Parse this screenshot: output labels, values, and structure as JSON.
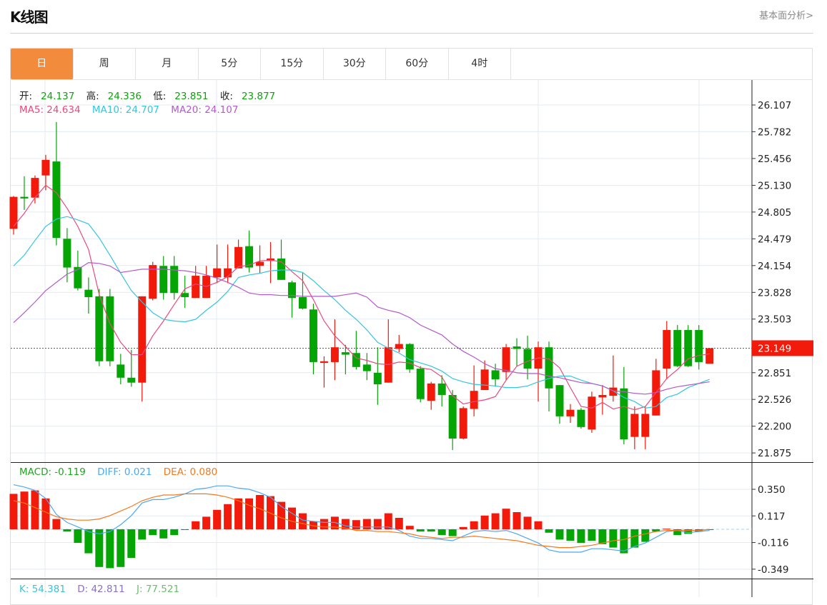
{
  "header": {
    "title": "K线图",
    "link": "基本面分析>"
  },
  "tabs": [
    {
      "label": "日",
      "active": true
    },
    {
      "label": "周"
    },
    {
      "label": "月"
    },
    {
      "label": "5分"
    },
    {
      "label": "15分"
    },
    {
      "label": "30分"
    },
    {
      "label": "60分"
    },
    {
      "label": "4时"
    }
  ],
  "ohlc_legend": {
    "open_label": "开:",
    "open": "24.137",
    "high_label": "高:",
    "high": "24.336",
    "low_label": "低:",
    "low": "23.851",
    "close_label": "收:",
    "close": "23.877"
  },
  "ma_legend": {
    "ma5": "MA5: 24.634",
    "ma10": "MA10: 24.707",
    "ma20": "MA20: 24.107"
  },
  "macd_legend": {
    "macd": "MACD: -0.119",
    "diff": "DIFF: 0.021",
    "dea": "DEA: 0.080"
  },
  "kdj_legend": {
    "k": "K: 54.381",
    "d": "D: 42.811",
    "j": "J: 77.521"
  },
  "colors": {
    "up": "#f21a0a",
    "down": "#06a506",
    "ma5": "#e94a7d",
    "ma10": "#34c6dc",
    "ma20": "#b35ac9",
    "diff": "#4fa8f2",
    "dea": "#f5791b",
    "accent": "#f28c3c"
  },
  "chart_data": [
    {
      "type": "candlestick",
      "title": "K线图",
      "y_ticks": [
        "26.107",
        "25.782",
        "25.456",
        "25.130",
        "24.805",
        "24.479",
        "24.154",
        "23.828",
        "23.503",
        "23.149",
        "22.851",
        "22.526",
        "22.200",
        "21.875"
      ],
      "ylim": [
        21.875,
        26.107
      ],
      "last_price": "23.149",
      "ohlc": [
        [
          24.6,
          25.0,
          24.53,
          24.99
        ],
        [
          24.99,
          25.24,
          24.83,
          24.97
        ],
        [
          24.98,
          25.25,
          24.91,
          25.22
        ],
        [
          25.25,
          25.5,
          25.07,
          25.44
        ],
        [
          25.42,
          25.9,
          24.4,
          24.49
        ],
        [
          24.48,
          24.61,
          23.95,
          24.13
        ],
        [
          24.137,
          24.336,
          23.851,
          23.877
        ],
        [
          23.86,
          24.01,
          23.57,
          23.77
        ],
        [
          23.78,
          23.87,
          22.93,
          22.99
        ],
        [
          23.78,
          23.87,
          22.93,
          22.99
        ],
        [
          22.95,
          23.08,
          22.71,
          22.79
        ],
        [
          22.79,
          23.13,
          22.68,
          22.73
        ],
        [
          22.73,
          23.78,
          22.5,
          23.78
        ],
        [
          23.75,
          24.2,
          23.73,
          24.16
        ],
        [
          24.15,
          24.27,
          23.74,
          23.82
        ],
        [
          24.15,
          24.27,
          23.74,
          23.82
        ],
        [
          23.82,
          24.03,
          23.64,
          23.77
        ],
        [
          23.76,
          24.15,
          23.76,
          24.03
        ],
        [
          23.76,
          24.15,
          23.76,
          24.03
        ],
        [
          24.01,
          24.41,
          23.94,
          24.12
        ],
        [
          24.01,
          24.41,
          23.94,
          24.12
        ],
        [
          24.12,
          24.47,
          24.12,
          24.38
        ],
        [
          24.39,
          24.58,
          24.07,
          24.13
        ],
        [
          24.15,
          24.4,
          24.06,
          24.2
        ],
        [
          24.21,
          24.44,
          23.94,
          24.24
        ],
        [
          24.24,
          24.47,
          23.98,
          23.98
        ],
        [
          23.95,
          23.97,
          23.52,
          23.76
        ],
        [
          23.77,
          24.07,
          23.62,
          23.63
        ],
        [
          23.62,
          23.69,
          22.83,
          22.98
        ],
        [
          22.97,
          23.05,
          22.67,
          22.99
        ],
        [
          22.98,
          23.5,
          22.76,
          23.16
        ],
        [
          23.1,
          23.19,
          22.83,
          23.07
        ],
        [
          23.09,
          23.36,
          22.89,
          22.92
        ],
        [
          22.95,
          23.09,
          22.76,
          22.87
        ],
        [
          22.85,
          23.16,
          22.46,
          22.71
        ],
        [
          22.73,
          23.5,
          22.73,
          23.16
        ],
        [
          23.14,
          23.31,
          23.1,
          23.2
        ],
        [
          23.2,
          23.21,
          22.85,
          22.89
        ],
        [
          22.9,
          22.93,
          22.49,
          22.53
        ],
        [
          22.51,
          22.74,
          22.4,
          22.72
        ],
        [
          22.72,
          22.82,
          22.44,
          22.58
        ],
        [
          22.58,
          22.64,
          21.91,
          22.05
        ],
        [
          22.05,
          22.44,
          22.04,
          22.42
        ],
        [
          22.41,
          22.94,
          22.32,
          22.63
        ],
        [
          22.64,
          23.0,
          22.64,
          22.89
        ],
        [
          22.88,
          22.96,
          22.68,
          22.77
        ],
        [
          22.86,
          23.2,
          22.76,
          23.16
        ],
        [
          23.17,
          23.27,
          22.93,
          23.14
        ],
        [
          23.14,
          23.3,
          22.77,
          22.9
        ],
        [
          22.9,
          23.23,
          22.5,
          23.16
        ],
        [
          23.16,
          23.23,
          22.38,
          22.66
        ],
        [
          22.7,
          22.7,
          22.23,
          22.32
        ],
        [
          22.32,
          22.47,
          22.24,
          22.4
        ],
        [
          22.4,
          22.42,
          22.17,
          22.19
        ],
        [
          22.16,
          22.62,
          22.12,
          22.56
        ],
        [
          22.55,
          22.7,
          22.34,
          22.58
        ],
        [
          22.57,
          23.06,
          22.5,
          22.67
        ],
        [
          22.66,
          22.92,
          21.98,
          22.04
        ],
        [
          22.07,
          22.44,
          21.92,
          22.35
        ],
        [
          22.07,
          22.44,
          21.92,
          22.35
        ],
        [
          22.33,
          23.02,
          22.33,
          22.88
        ],
        [
          22.9,
          23.48,
          22.77,
          23.37
        ],
        [
          23.37,
          23.43,
          22.92,
          22.93
        ],
        [
          23.37,
          23.43,
          22.92,
          22.93
        ],
        [
          23.37,
          23.43,
          22.89,
          22.98
        ],
        [
          22.96,
          23.149,
          22.96,
          23.149
        ]
      ],
      "series": [
        {
          "name": "MA5",
          "values": [
            24.63,
            24.79,
            24.98,
            25.13,
            25.04,
            24.85,
            24.63,
            24.35,
            23.8,
            23.45,
            23.22,
            23.07,
            23.07,
            23.3,
            23.48,
            23.68,
            23.87,
            23.93,
            23.9,
            23.95,
            24.02,
            24.14,
            24.16,
            24.21,
            24.22,
            24.2,
            24.08,
            23.97,
            23.74,
            23.48,
            23.3,
            23.17,
            23.03,
            23.0,
            22.96,
            22.95,
            22.98,
            22.97,
            22.91,
            22.89,
            22.8,
            22.57,
            22.47,
            22.5,
            22.52,
            22.56,
            22.76,
            22.93,
            22.99,
            23.03,
            23.02,
            22.91,
            22.67,
            22.44,
            22.42,
            22.49,
            22.41,
            22.44,
            22.4,
            22.44,
            22.61,
            22.78,
            22.89,
            23.02,
            23.06,
            23.08
          ]
        },
        {
          "name": "MA10",
          "values": [
            24.15,
            24.28,
            24.46,
            24.63,
            24.72,
            24.75,
            24.71,
            24.66,
            24.49,
            24.28,
            24.06,
            23.85,
            23.71,
            23.58,
            23.5,
            23.48,
            23.47,
            23.5,
            23.61,
            23.71,
            23.84,
            24.01,
            24.04,
            24.06,
            24.09,
            24.1,
            24.1,
            24.07,
            23.97,
            23.85,
            23.74,
            23.61,
            23.5,
            23.37,
            23.22,
            23.15,
            23.09,
            23.01,
            22.97,
            22.93,
            22.87,
            22.78,
            22.74,
            22.71,
            22.7,
            22.69,
            22.67,
            22.67,
            22.69,
            22.74,
            22.78,
            22.81,
            22.81,
            22.76,
            22.72,
            22.69,
            22.63,
            22.55,
            22.5,
            22.42,
            22.44,
            22.55,
            22.59,
            22.67,
            22.72,
            22.77
          ]
        },
        {
          "name": "MA20",
          "values": [
            23.46,
            23.58,
            23.71,
            23.85,
            23.95,
            24.05,
            24.107,
            24.19,
            24.18,
            24.15,
            24.07,
            24.09,
            24.11,
            24.11,
            24.11,
            24.1,
            24.09,
            24.07,
            24.04,
            24.0,
            23.95,
            23.89,
            23.82,
            23.8,
            23.8,
            23.79,
            23.79,
            23.78,
            23.78,
            23.78,
            23.78,
            23.8,
            23.82,
            23.77,
            23.65,
            23.61,
            23.58,
            23.52,
            23.43,
            23.37,
            23.31,
            23.2,
            23.11,
            23.04,
            22.96,
            22.9,
            22.88,
            22.85,
            22.84,
            22.84,
            22.81,
            22.79,
            22.76,
            22.73,
            22.72,
            22.69,
            22.63,
            22.62,
            22.6,
            22.59,
            22.61,
            22.65,
            22.68,
            22.7,
            22.72,
            22.74
          ]
        }
      ]
    },
    {
      "type": "bar+line",
      "title": "MACD",
      "y_ticks": [
        "0.350",
        "0.117",
        "-0.116",
        "-0.349"
      ],
      "ylim": [
        -0.349,
        0.35
      ],
      "series": [
        {
          "name": "MACD",
          "values": [
            0.31,
            0.33,
            0.34,
            0.27,
            0.09,
            -0.02,
            -0.119,
            -0.21,
            -0.33,
            -0.34,
            -0.33,
            -0.25,
            -0.09,
            -0.05,
            -0.08,
            -0.05,
            -0.005,
            0.07,
            0.11,
            0.17,
            0.22,
            0.27,
            0.27,
            0.3,
            0.29,
            0.24,
            0.19,
            0.14,
            0.07,
            0.09,
            0.11,
            0.09,
            0.08,
            0.09,
            0.09,
            0.14,
            0.1,
            0.03,
            -0.02,
            -0.02,
            -0.05,
            -0.06,
            0.02,
            0.07,
            0.12,
            0.14,
            0.18,
            0.15,
            0.11,
            0.07,
            -0.03,
            -0.09,
            -0.1,
            -0.12,
            -0.1,
            -0.13,
            -0.16,
            -0.21,
            -0.16,
            -0.11,
            -0.02,
            0.005,
            -0.05,
            -0.04,
            -0.02,
            -0.005
          ]
        },
        {
          "name": "DIFF",
          "values": [
            0.39,
            0.37,
            0.34,
            0.27,
            0.13,
            0.06,
            0.021,
            -0.02,
            -0.04,
            -0.02,
            0.04,
            0.12,
            0.23,
            0.26,
            0.26,
            0.28,
            0.31,
            0.35,
            0.36,
            0.38,
            0.38,
            0.36,
            0.35,
            0.32,
            0.28,
            0.2,
            0.14,
            0.08,
            0.07,
            0.06,
            0.06,
            0.03,
            0.02,
            0.02,
            0.02,
            0.02,
            -0.01,
            -0.06,
            -0.08,
            -0.08,
            -0.09,
            -0.1,
            -0.06,
            -0.02,
            -0.01,
            -0.02,
            -0.01,
            -0.04,
            -0.08,
            -0.12,
            -0.18,
            -0.2,
            -0.2,
            -0.2,
            -0.17,
            -0.17,
            -0.18,
            -0.19,
            -0.15,
            -0.12,
            -0.07,
            -0.02,
            -0.01,
            -0.03,
            -0.02,
            -0.01
          ]
        },
        {
          "name": "DEA",
          "values": [
            0.25,
            0.23,
            0.19,
            0.15,
            0.11,
            0.09,
            0.08,
            0.08,
            0.09,
            0.12,
            0.16,
            0.2,
            0.25,
            0.28,
            0.3,
            0.3,
            0.31,
            0.31,
            0.31,
            0.3,
            0.28,
            0.25,
            0.21,
            0.18,
            0.14,
            0.1,
            0.07,
            0.05,
            0.03,
            0.02,
            0.02,
            0.01,
            -0.01,
            -0.01,
            -0.02,
            -0.02,
            -0.03,
            -0.04,
            -0.06,
            -0.07,
            -0.08,
            -0.07,
            -0.07,
            -0.06,
            -0.07,
            -0.08,
            -0.09,
            -0.1,
            -0.12,
            -0.14,
            -0.15,
            -0.16,
            -0.16,
            -0.15,
            -0.14,
            -0.12,
            -0.1,
            -0.09,
            -0.06,
            -0.04,
            -0.02,
            -0.01,
            -0.01,
            -0.01,
            -0.01,
            0.0
          ]
        }
      ]
    }
  ]
}
